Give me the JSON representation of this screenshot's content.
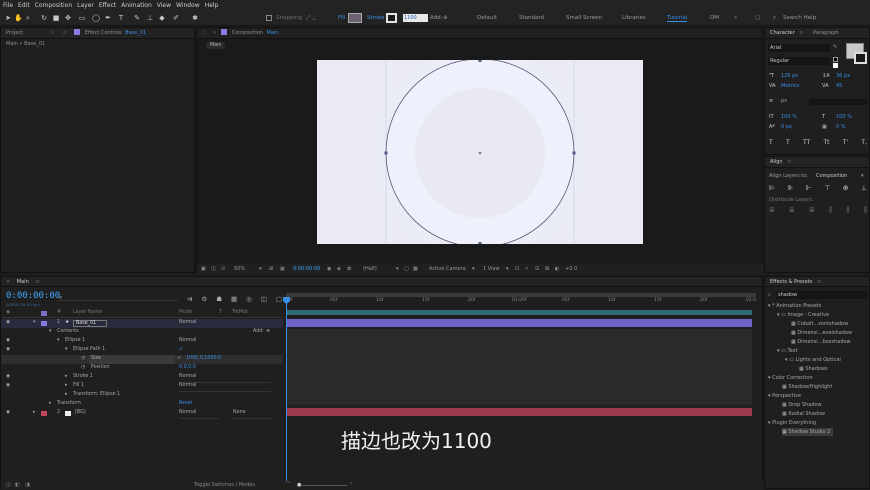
{
  "menu": [
    "File",
    "Edit",
    "Composition",
    "Layer",
    "Effect",
    "Animation",
    "View",
    "Window",
    "Help"
  ],
  "toolbar": {
    "snapping": "Snapping",
    "fill": "Fill",
    "stroke": "Stroke",
    "stroke_width": "1100",
    "add": "Add:",
    "workspaces": [
      "Default",
      "Standard",
      "Small Screen",
      "Libraries",
      "Tutorial",
      "DM"
    ],
    "active_workspace": "Tutorial",
    "search": "Search Help"
  },
  "project_panel": {
    "tab_project": "Project",
    "tab_effect_controls": "Effect Controls",
    "effect_layer": "Base_01",
    "breadcrumb": "Main • Base_01"
  },
  "comp_panel": {
    "tab_label": "Composition",
    "comp_name": "Main",
    "crumb": "Main",
    "zoom": "50%",
    "timecode": "0:00:00:00",
    "resolution": "(Half)",
    "camera": "Active Camera",
    "view": "1 View",
    "exposure": "+0.0"
  },
  "timeline": {
    "tab": "Main",
    "timecode": "0:00:00:00",
    "timecode_sub": "00000 (25.00 fps)",
    "headers": {
      "layer_name": "Layer Name",
      "mode": "Mode",
      "t": "T",
      "trkmat": "TrkMat"
    },
    "layers": [
      {
        "num": "1",
        "name": "Base_01",
        "mode": "Normal"
      },
      {
        "num": "2",
        "name": "[BG]",
        "mode": "Normal",
        "trkmat": "None"
      }
    ],
    "contents": "Contents",
    "add": "Add:",
    "ellipse": "Ellipse 1",
    "ellipse_path": "Ellipse Path 1",
    "size": "Size",
    "size_value": "1000.0,1000.0",
    "position": "Position",
    "position_value": "0.0,0.0",
    "stroke": "Stroke 1",
    "stroke_mode": "Normal",
    "fill": "Fill 1",
    "fill_mode": "Normal",
    "transform_ellipse": "Transform: Ellipse 1",
    "transform": "Transform",
    "reset": "Reset",
    "ruler": [
      "0f",
      "05f",
      "10f",
      "15f",
      "20f",
      "01:00f",
      "05f",
      "10f",
      "15f",
      "20f",
      "02:0"
    ],
    "toggle": "Toggle Switches / Modes",
    "subtitle": "描边也改为1100"
  },
  "character": {
    "tab_character": "Character",
    "tab_paragraph": "Paragraph",
    "font": "Arial",
    "style": "Regular",
    "size": "126 px",
    "leading": "36 px",
    "tracking": "Metrics",
    "kerning": "45",
    "stroke_unit": "px",
    "vscale": "100 %",
    "hscale": "100 %",
    "baseline": "0 px",
    "tsume": "0 %",
    "styles": [
      "T",
      "T",
      "TT",
      "Tt",
      "T'",
      "T,"
    ]
  },
  "align": {
    "tab": "Align",
    "align_to_label": "Align Layers to:",
    "align_to": "Composition",
    "distribute": "Distribute Layers:"
  },
  "effects": {
    "tab": "Effects & Presets",
    "search": "shadow",
    "tree": [
      {
        "label": "* Animation Presets",
        "level": 0
      },
      {
        "label": "Image - Creative",
        "level": 1
      },
      {
        "label": "Cobalt...zontshadow",
        "level": 2
      },
      {
        "label": "Dimensi...evelshadow",
        "level": 2
      },
      {
        "label": "Dimensi...boxshadow",
        "level": 2
      },
      {
        "label": "Text",
        "level": 1
      },
      {
        "label": "Lights and Optical",
        "level": 2
      },
      {
        "label": "Shadows",
        "level": 3
      },
      {
        "label": "Color Correction",
        "level": 0
      },
      {
        "label": "Shadow/Highlight",
        "level": 1
      },
      {
        "label": "Perspective",
        "level": 0
      },
      {
        "label": "Drop Shadow",
        "level": 1
      },
      {
        "label": "Radial Shadow",
        "level": 1
      },
      {
        "label": "Plugin Everything",
        "level": 0
      },
      {
        "label": "Shadow Studio 2",
        "level": 1
      }
    ]
  },
  "colors": {
    "accent": "#2d8ceb",
    "timecode": "#3fa7ff",
    "layer1": "#6e63c8",
    "layer2": "#9e3a4e",
    "canvas": "#e9eaf3"
  }
}
